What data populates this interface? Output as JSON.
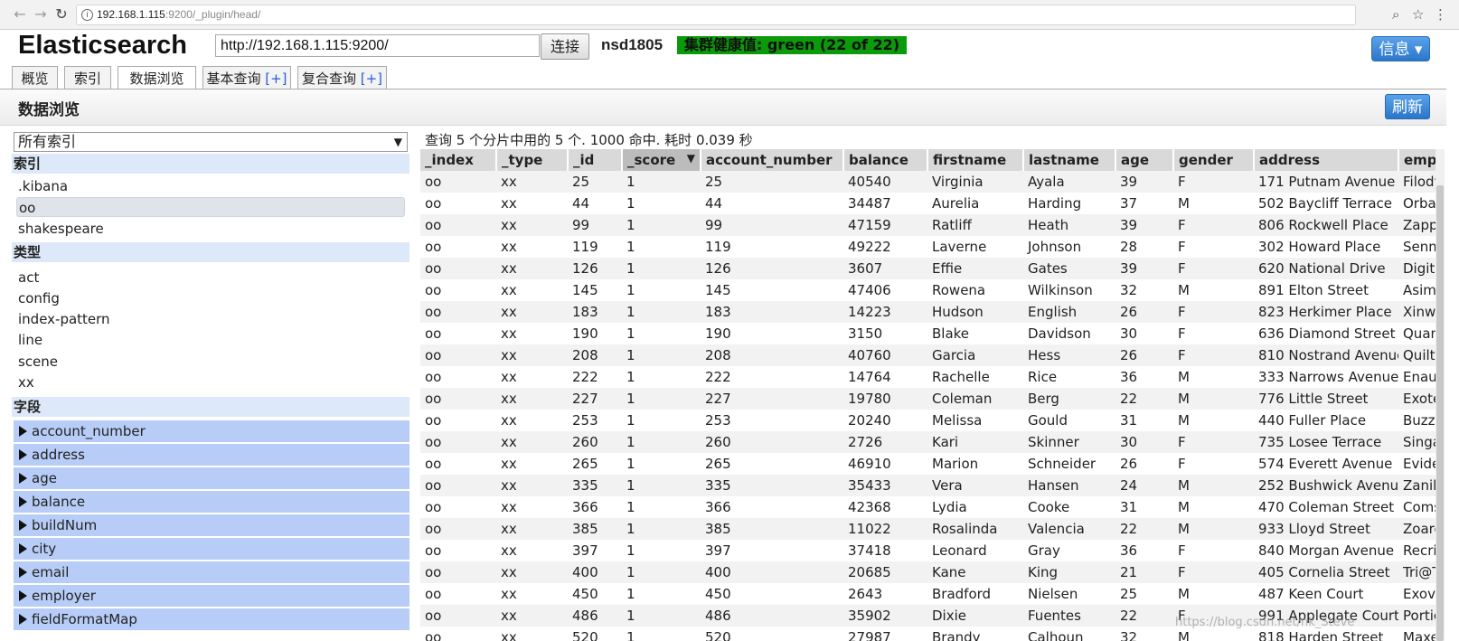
{
  "browser": {
    "url_host": "192.168.1.115",
    "url_path": ":9200/_plugin/head/"
  },
  "header": {
    "logo": "Elasticsearch",
    "server_url": "http://192.168.1.115:9200/",
    "connect_label": "连接",
    "cluster_name": "nsd1805",
    "health": "集群健康值: green (22 of 22)",
    "info_label": "信息 ▾"
  },
  "tabs": [
    {
      "label": "概览",
      "plus": ""
    },
    {
      "label": "索引",
      "plus": ""
    },
    {
      "label": "数据浏览",
      "plus": ""
    },
    {
      "label": "基本查询 ",
      "plus": "[+]"
    },
    {
      "label": "复合查询 ",
      "plus": "[+]"
    }
  ],
  "section": {
    "title": "数据浏览",
    "refresh_label": "刷新"
  },
  "sidebar": {
    "select_value": "所有索引",
    "index_heading": "索引",
    "indices": [
      ".kibana",
      "oo",
      "shakespeare"
    ],
    "type_heading": "类型",
    "types": [
      "act",
      "config",
      "index-pattern",
      "line",
      "scene",
      "xx"
    ],
    "field_heading": "字段",
    "fields": [
      "account_number",
      "address",
      "age",
      "balance",
      "buildNum",
      "city",
      "email",
      "employer",
      "fieldFormatMap"
    ]
  },
  "results": {
    "summary": "查询 5 个分片中用的 5 个. 1000 命中. 耗时 0.039 秒",
    "columns": [
      "_index",
      "_type",
      "_id",
      "_score",
      "account_number",
      "balance",
      "firstname",
      "lastname",
      "age",
      "gender",
      "address",
      "employer"
    ],
    "rows": [
      [
        "oo",
        "xx",
        "25",
        "1",
        "25",
        "40540",
        "Virginia",
        "Ayala",
        "39",
        "F",
        "171 Putnam Avenue",
        "Filodyne"
      ],
      [
        "oo",
        "xx",
        "44",
        "1",
        "44",
        "34487",
        "Aurelia",
        "Harding",
        "37",
        "M",
        "502 Baycliff Terrace",
        "Orbalix"
      ],
      [
        "oo",
        "xx",
        "99",
        "1",
        "99",
        "47159",
        "Ratliff",
        "Heath",
        "39",
        "F",
        "806 Rockwell Place",
        "Zappix"
      ],
      [
        "oo",
        "xx",
        "119",
        "1",
        "119",
        "49222",
        "Laverne",
        "Johnson",
        "28",
        "F",
        "302 Howard Place",
        "Senmei"
      ],
      [
        "oo",
        "xx",
        "126",
        "1",
        "126",
        "3607",
        "Effie",
        "Gates",
        "39",
        "F",
        "620 National Drive",
        "Digitalus"
      ],
      [
        "oo",
        "xx",
        "145",
        "1",
        "145",
        "47406",
        "Rowena",
        "Wilkinson",
        "32",
        "M",
        "891 Elton Street",
        "Asimiline"
      ],
      [
        "oo",
        "xx",
        "183",
        "1",
        "183",
        "14223",
        "Hudson",
        "English",
        "26",
        "F",
        "823 Herkimer Place",
        "Xinware"
      ],
      [
        "oo",
        "xx",
        "190",
        "1",
        "190",
        "3150",
        "Blake",
        "Davidson",
        "30",
        "F",
        "636 Diamond Street",
        "Quantasis"
      ],
      [
        "oo",
        "xx",
        "208",
        "1",
        "208",
        "40760",
        "Garcia",
        "Hess",
        "26",
        "F",
        "810 Nostrand Avenue",
        "Quiltigen"
      ],
      [
        "oo",
        "xx",
        "222",
        "1",
        "222",
        "14764",
        "Rachelle",
        "Rice",
        "36",
        "M",
        "333 Narrows Avenue",
        "Enaut"
      ],
      [
        "oo",
        "xx",
        "227",
        "1",
        "227",
        "19780",
        "Coleman",
        "Berg",
        "22",
        "M",
        "776 Little Street",
        "Exoteric"
      ],
      [
        "oo",
        "xx",
        "253",
        "1",
        "253",
        "20240",
        "Melissa",
        "Gould",
        "31",
        "M",
        "440 Fuller Place",
        "Buzzopia"
      ],
      [
        "oo",
        "xx",
        "260",
        "1",
        "260",
        "2726",
        "Kari",
        "Skinner",
        "30",
        "F",
        "735 Losee Terrace",
        "Singavera"
      ],
      [
        "oo",
        "xx",
        "265",
        "1",
        "265",
        "46910",
        "Marion",
        "Schneider",
        "26",
        "F",
        "574 Everett Avenue",
        "Evidends"
      ],
      [
        "oo",
        "xx",
        "335",
        "1",
        "335",
        "35433",
        "Vera",
        "Hansen",
        "24",
        "M",
        "252 Bushwick Avenue",
        "Zanilla"
      ],
      [
        "oo",
        "xx",
        "366",
        "1",
        "366",
        "42368",
        "Lydia",
        "Cooke",
        "31",
        "M",
        "470 Coleman Street",
        "Comstar"
      ],
      [
        "oo",
        "xx",
        "385",
        "1",
        "385",
        "11022",
        "Rosalinda",
        "Valencia",
        "22",
        "M",
        "933 Lloyd Street",
        "Zoarere"
      ],
      [
        "oo",
        "xx",
        "397",
        "1",
        "397",
        "37418",
        "Leonard",
        "Gray",
        "36",
        "F",
        "840 Morgan Avenue",
        "Recritube"
      ],
      [
        "oo",
        "xx",
        "400",
        "1",
        "400",
        "20685",
        "Kane",
        "King",
        "21",
        "F",
        "405 Cornelia Street",
        "Tri@Tribalog"
      ],
      [
        "oo",
        "xx",
        "450",
        "1",
        "450",
        "2643",
        "Bradford",
        "Nielsen",
        "25",
        "M",
        "487 Keen Court",
        "Exovent"
      ],
      [
        "oo",
        "xx",
        "486",
        "1",
        "486",
        "35902",
        "Dixie",
        "Fuentes",
        "22",
        "F",
        "991 Applegate Court",
        "Portico"
      ],
      [
        "oo",
        "xx",
        "520",
        "1",
        "520",
        "27987",
        "Brandy",
        "Calhoun",
        "32",
        "M",
        "818 Harden Street",
        "Maxemia"
      ]
    ]
  },
  "watermark": "https://blog.csdn.net/nk_Steve"
}
